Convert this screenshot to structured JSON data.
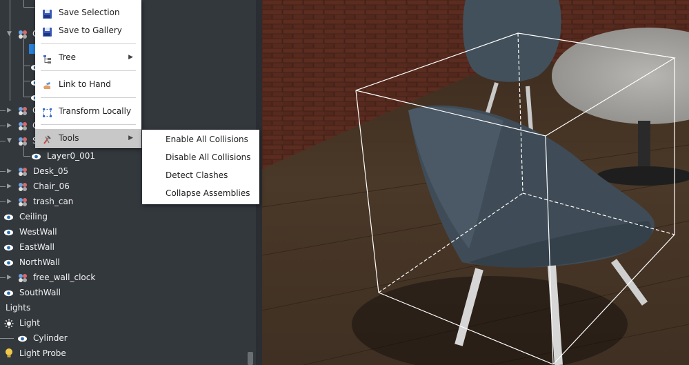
{
  "tree": {
    "items": [
      {
        "label": "",
        "y": 0
      },
      {
        "label": "Layer0_001",
        "icon": "eye-icon"
      },
      {
        "label": "Desk_05",
        "icon": "cluster-icon"
      },
      {
        "label": "Chair_06",
        "icon": "cluster-icon"
      },
      {
        "label": "trash_can",
        "icon": "cluster-icon"
      },
      {
        "label": "Ceiling",
        "icon": "eye-icon"
      },
      {
        "label": "WestWall",
        "icon": "eye-icon"
      },
      {
        "label": "EastWall",
        "icon": "eye-icon"
      },
      {
        "label": "NorthWall",
        "icon": "eye-icon"
      },
      {
        "label": "free_wall_clock",
        "icon": "cluster-icon"
      },
      {
        "label": "SouthWall",
        "icon": "eye-icon"
      },
      {
        "label": "Lights",
        "icon": ""
      },
      {
        "label": "Light",
        "icon": "sun-icon"
      },
      {
        "label": "Cylinder",
        "icon": "eye-icon"
      },
      {
        "label": "Light Probe",
        "icon": "bulb-icon"
      }
    ],
    "partial_labels": [
      "C",
      "C",
      "C",
      "S"
    ]
  },
  "context_menu": {
    "items": [
      {
        "label": "Save Selection",
        "icon": "floppy-icon"
      },
      {
        "label": "Save to Gallery",
        "icon": "floppy-icon"
      },
      {
        "label": "Tree",
        "icon": "tree-icon",
        "submenu": true
      },
      {
        "label": "Link to Hand",
        "icon": "hand-icon"
      },
      {
        "label": "Transform Locally",
        "icon": "transform-icon"
      },
      {
        "label": "Tools",
        "icon": "tools-icon",
        "submenu": true,
        "highlighted": true
      }
    ]
  },
  "tools_submenu": {
    "items": [
      {
        "label": "Enable All Collisions"
      },
      {
        "label": "Disable All Collisions"
      },
      {
        "label": "Detect Clashes"
      },
      {
        "label": "Collapse Assemblies"
      }
    ]
  },
  "colors": {
    "panel_bg": "#33383d",
    "menu_bg": "#ffffff",
    "menu_highlight": "#c8c8c8",
    "accent_blue": "#2a7fd8"
  }
}
